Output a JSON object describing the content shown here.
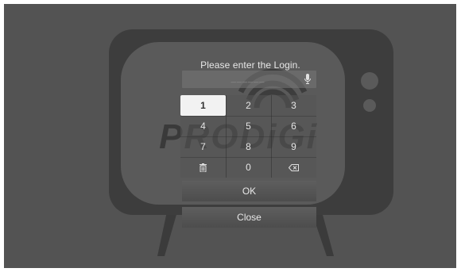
{
  "dialog": {
    "prompt": "Please enter the Login.",
    "login_mask": "______",
    "keypad": {
      "keys": [
        "1",
        "2",
        "3",
        "4",
        "5",
        "6",
        "7",
        "8",
        "9",
        "delete-icon",
        "0",
        "backspace-icon"
      ],
      "selected": "1"
    },
    "ok_label": "OK",
    "close_label": "Close"
  },
  "background": {
    "brand_watermark": "PRODiGi"
  },
  "colors": {
    "backdrop": "#535353",
    "tv": "#3d3d3d",
    "selected_key": "#f2f2f2"
  },
  "icons": [
    "mic-icon",
    "delete-icon",
    "backspace-icon",
    "wifi-icon",
    "tv-icon"
  ]
}
